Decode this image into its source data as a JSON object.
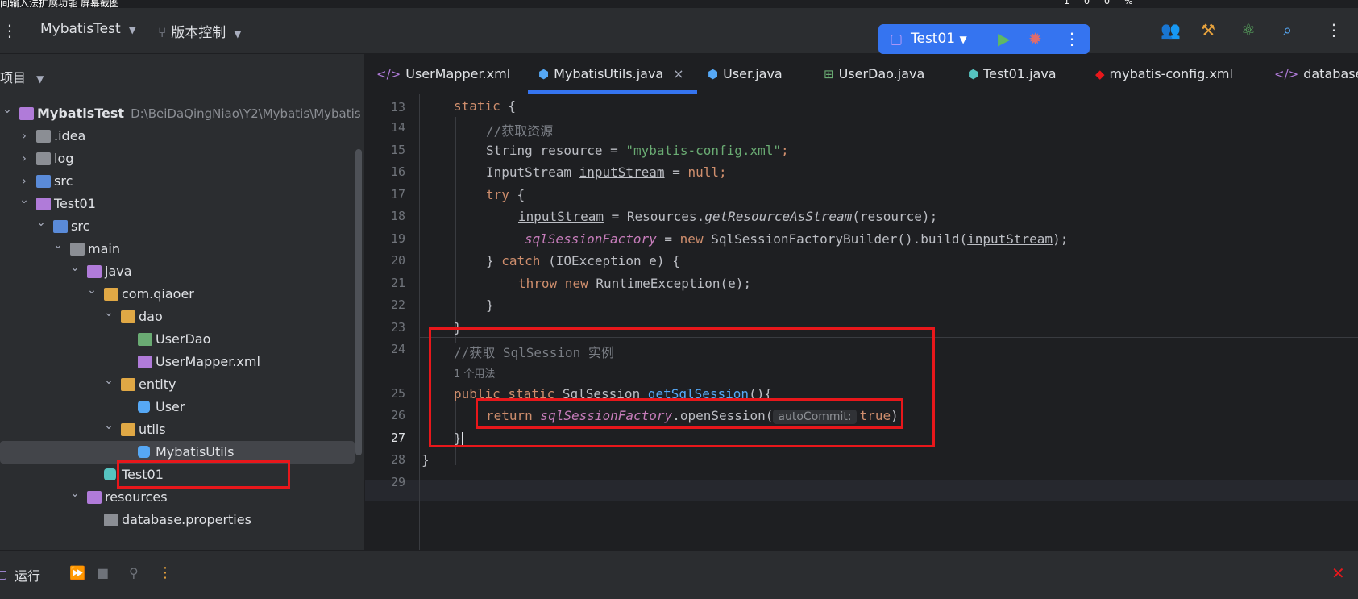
{
  "os_bar": {
    "left_text": "间输入法扩展功能 屏幕截图",
    "right_text": "100%"
  },
  "toolbar": {
    "project_name": "MybatisTest",
    "vcs_label": "版本控制",
    "run_config": "Test01",
    "accent": "#3574f0"
  },
  "project_panel": {
    "header": "项目",
    "tree": [
      {
        "label": "MybatisTest",
        "path": "D:\\BeiDaQingNiao\\Y2\\Mybatis\\Mybatis",
        "indent": 0,
        "arrow": "down",
        "icon": "module-icon",
        "bold": true
      },
      {
        "label": ".idea",
        "indent": 1,
        "arrow": "right",
        "icon": "folder-icon"
      },
      {
        "label": "log",
        "indent": 1,
        "arrow": "right",
        "icon": "folder-icon"
      },
      {
        "label": "src",
        "indent": 1,
        "arrow": "right",
        "icon": "source-folder-icon"
      },
      {
        "label": "Test01",
        "indent": 1,
        "arrow": "down",
        "icon": "module-icon"
      },
      {
        "label": "src",
        "indent": 2,
        "arrow": "down",
        "icon": "source-folder-icon"
      },
      {
        "label": "main",
        "indent": 3,
        "arrow": "down",
        "icon": "folder-icon"
      },
      {
        "label": "java",
        "indent": 4,
        "arrow": "down",
        "icon": "java-folder-icon"
      },
      {
        "label": "com.qiaoer",
        "indent": 5,
        "arrow": "down",
        "icon": "package-icon"
      },
      {
        "label": "dao",
        "indent": 6,
        "arrow": "down",
        "icon": "package-icon"
      },
      {
        "label": "UserDao",
        "indent": 7,
        "arrow": "",
        "icon": "interface-icon"
      },
      {
        "label": "UserMapper.xml",
        "indent": 7,
        "arrow": "",
        "icon": "xml-icon"
      },
      {
        "label": "entity",
        "indent": 6,
        "arrow": "down",
        "icon": "package-icon"
      },
      {
        "label": "User",
        "indent": 7,
        "arrow": "",
        "icon": "class-icon"
      },
      {
        "label": "utils",
        "indent": 6,
        "arrow": "down",
        "icon": "package-icon"
      },
      {
        "label": "MybatisUtils",
        "indent": 7,
        "arrow": "",
        "icon": "class-icon",
        "selected": true
      },
      {
        "label": "Test01",
        "indent": 5,
        "arrow": "",
        "icon": "test-class-icon"
      },
      {
        "label": "resources",
        "indent": 4,
        "arrow": "down",
        "icon": "resources-folder-icon"
      },
      {
        "label": "database.properties",
        "indent": 5,
        "arrow": "",
        "icon": "properties-icon"
      }
    ]
  },
  "editor": {
    "tabs": [
      {
        "label": "UserMapper.xml",
        "icon": "</>"
      },
      {
        "label": "MybatisUtils.java",
        "icon": "⬢",
        "active": true,
        "close": "×"
      },
      {
        "label": "User.java",
        "icon": "⬢"
      },
      {
        "label": "UserDao.java",
        "icon": "⊞"
      },
      {
        "label": "Test01.java",
        "icon": "⬢"
      },
      {
        "label": "mybatis-config.xml",
        "icon": "◆"
      },
      {
        "label": "database",
        "icon": "</>"
      }
    ],
    "line_numbers": [
      "13",
      "14",
      "15",
      "16",
      "17",
      "18",
      "19",
      "20",
      "21",
      "22",
      "23",
      "24",
      "25",
      "26",
      "27",
      "28",
      "29"
    ],
    "usage_hint": "1 个用法",
    "inlay_hint": "autoCommit:",
    "code_text": {
      "l13_kw": "static",
      "l13_b": " {",
      "l14": "//获取资源",
      "l15_a": "String resource = ",
      "l15_s": "\"mybatis-config.xml\"",
      "l15_b": ";",
      "l16_a": "InputStream ",
      "l16_v": "inputStream",
      "l16_b": " = ",
      "l16_n": "null",
      "l16_c": ";",
      "l17_kw": "try",
      "l17_b": " {",
      "l18_v": "inputStream",
      "l18_a": " = Resources.",
      "l18_m": "getResourceAsStream",
      "l18_b": "(resource);",
      "l19_f": "sqlSessionFactory",
      "l19_a": " = ",
      "l19_kw": "new",
      "l19_b": " SqlSessionFactoryBuilder().build(",
      "l19_v": "inputStream",
      "l19_c": ");",
      "l20_a": "} ",
      "l20_kw": "catch",
      "l20_b": " (IOException e) {",
      "l21_kw1": "throw",
      "l21_kw2": " new",
      "l21_b": " RuntimeException(e);",
      "l22": "}",
      "l23": "}",
      "l24": "//获取 SqlSession 实例",
      "l25_kw": "public static",
      "l25_a": " SqlSession ",
      "l25_m": "getSqlSession",
      "l25_b": "(){",
      "l26_kw": "return",
      "l26_f": " sqlSessionFactory",
      "l26_a": ".openSession(",
      "l26_t": "true",
      "l26_b": ");",
      "l27": "}",
      "l28": "}"
    }
  },
  "bottom_bar": {
    "run_label": "运行"
  }
}
